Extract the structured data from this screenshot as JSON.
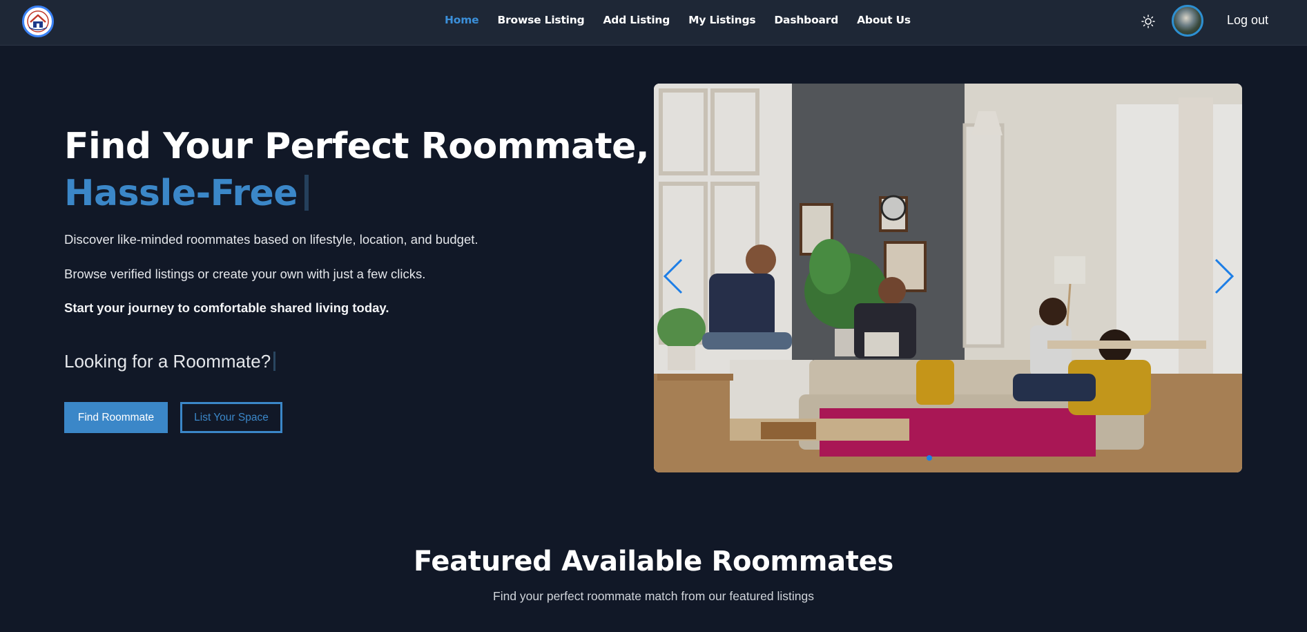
{
  "nav": {
    "logo_icon": "house-logo-icon",
    "links": [
      {
        "label": "Home",
        "active": true
      },
      {
        "label": "Browse Listing",
        "active": false
      },
      {
        "label": "Add Listing",
        "active": false
      },
      {
        "label": "My Listings",
        "active": false
      },
      {
        "label": "Dashboard",
        "active": false
      },
      {
        "label": "About Us",
        "active": false
      }
    ],
    "theme_icon": "sun-icon",
    "logout_label": "Log out"
  },
  "hero": {
    "title_line1": "Find Your Perfect Roommate,",
    "title_line2": "Hassle-Free",
    "paragraph1": "Discover like-minded roommates based on lifestyle, location, and budget.",
    "paragraph2": "Browse verified listings or create your own with just a few clicks.",
    "paragraph3": "Start your journey to comfortable shared living today.",
    "looking_text": "Looking for a Roommate?",
    "primary_button": "Find Roommate",
    "secondary_button": "List Your Space"
  },
  "carousel": {
    "prev_icon": "chevron-left-icon",
    "next_icon": "chevron-right-icon",
    "slide_count": 1,
    "active_slide": 1
  },
  "featured": {
    "title": "Featured Available Roommates",
    "subtitle": "Find your perfect roommate match from our featured listings"
  },
  "colors": {
    "background": "#111827",
    "navbar": "#1e2736",
    "accent": "#3b87c8",
    "active_link": "#3b8fd9",
    "carousel_arrow": "#1d7ee6"
  }
}
